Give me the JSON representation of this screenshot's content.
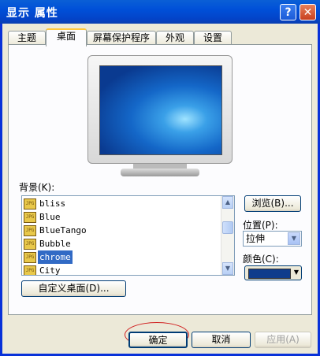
{
  "window": {
    "title": "显示 属性",
    "help_glyph": "?",
    "close_glyph": "✕"
  },
  "tabs": [
    {
      "label": "主题",
      "active": false
    },
    {
      "label": "桌面",
      "active": true
    },
    {
      "label": "屏幕保护程序",
      "active": false
    },
    {
      "label": "外观",
      "active": false
    },
    {
      "label": "设置",
      "active": false
    }
  ],
  "background_label": "背景(K):",
  "background_list": [
    {
      "name": "bliss",
      "icon_text": "JPG"
    },
    {
      "name": "Blue",
      "icon_text": "JPG"
    },
    {
      "name": "BlueTango",
      "icon_text": "JPG"
    },
    {
      "name": "Bubble",
      "icon_text": "JPG"
    },
    {
      "name": "chrome",
      "icon_text": "JPG",
      "selected": true
    },
    {
      "name": "City",
      "icon_text": "JPG"
    }
  ],
  "browse_button": "浏览(B)...",
  "position_label": "位置(P):",
  "position_value": "拉伸",
  "color_label": "颜色(C):",
  "color_value": "#0f3c8c",
  "customize_button": "自定义桌面(D)...",
  "ok_button": "确定",
  "cancel_button": "取消",
  "apply_button": "应用(A)"
}
